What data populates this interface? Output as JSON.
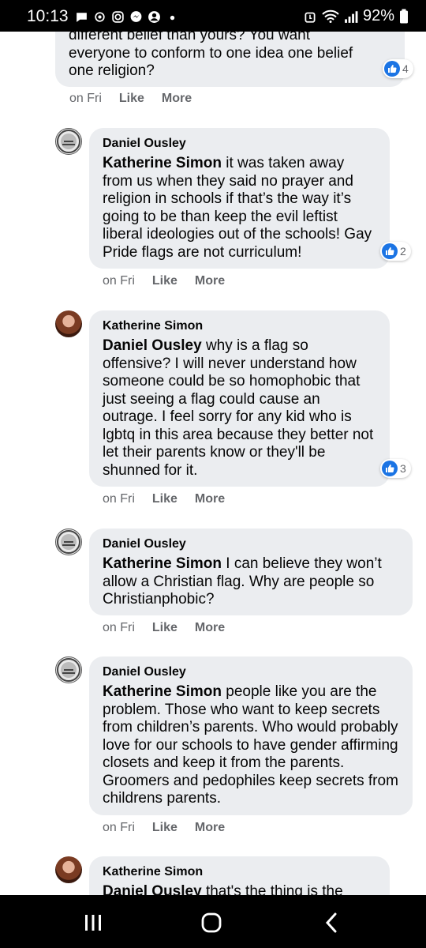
{
  "status_bar": {
    "time": "10:13",
    "battery_text": "92%"
  },
  "comments": [
    {
      "author": "",
      "mention": "",
      "text": "different belief than yours? You want everyone to conform to one idea one belief one religion?",
      "lines": [
        "different belief than yours? You want",
        "everyone to conform to one idea one belief",
        "one religion?"
      ],
      "reaction_count": "4",
      "time": "on Fri",
      "like": "Like",
      "more": "More"
    },
    {
      "author": "Daniel Ousley",
      "mention": "Katherine Simon",
      "text": "it was taken away from us when they said no prayer and religion in schools if that’s the way it’s going to be than keep the evil leftist liberal ideologies out of the schools! Gay Pride flags are not curriculum!",
      "reaction_count": "2",
      "time": "on Fri",
      "like": "Like",
      "more": "More"
    },
    {
      "author": "Katherine Simon",
      "mention": "Daniel Ousley",
      "text": "why is a flag so offensive? I will never understand how someone could be so homophobic that just seeing a flag could cause an outrage. I feel sorry for any kid who is lgbtq in this area because they better not let their parents know or they'll be shunned for it.",
      "reaction_count": "3",
      "time": "on Fri",
      "like": "Like",
      "more": "More"
    },
    {
      "author": "Daniel Ousley",
      "mention": "Katherine Simon",
      "text": "I can believe they won’t allow a Christian flag. Why are people so Christianphobic?",
      "time": "on Fri",
      "like": "Like",
      "more": "More"
    },
    {
      "author": "Daniel Ousley",
      "mention": "Katherine Simon",
      "text": "people like you are the problem. Those who want to keep secrets from children’s parents. Who would probably love for our schools to have gender affirming closets and keep it from the parents. Groomers and pedophiles keep secrets from childrens parents.",
      "time": "on Fri",
      "like": "Like",
      "more": "More"
    },
    {
      "author": "Katherine Simon",
      "mention": "Daniel Ousley",
      "text": "that's the thing is the"
    }
  ],
  "colors": {
    "bubble": "#ebedf0",
    "like_blue": "#1b74e4",
    "meta_gray": "#65676b"
  },
  "icons": {
    "avatar_daniel": "seal-avatar",
    "avatar_katherine": "photo-avatar",
    "nav_recents": "recents-icon",
    "nav_home": "home-icon",
    "nav_back": "back-icon"
  }
}
